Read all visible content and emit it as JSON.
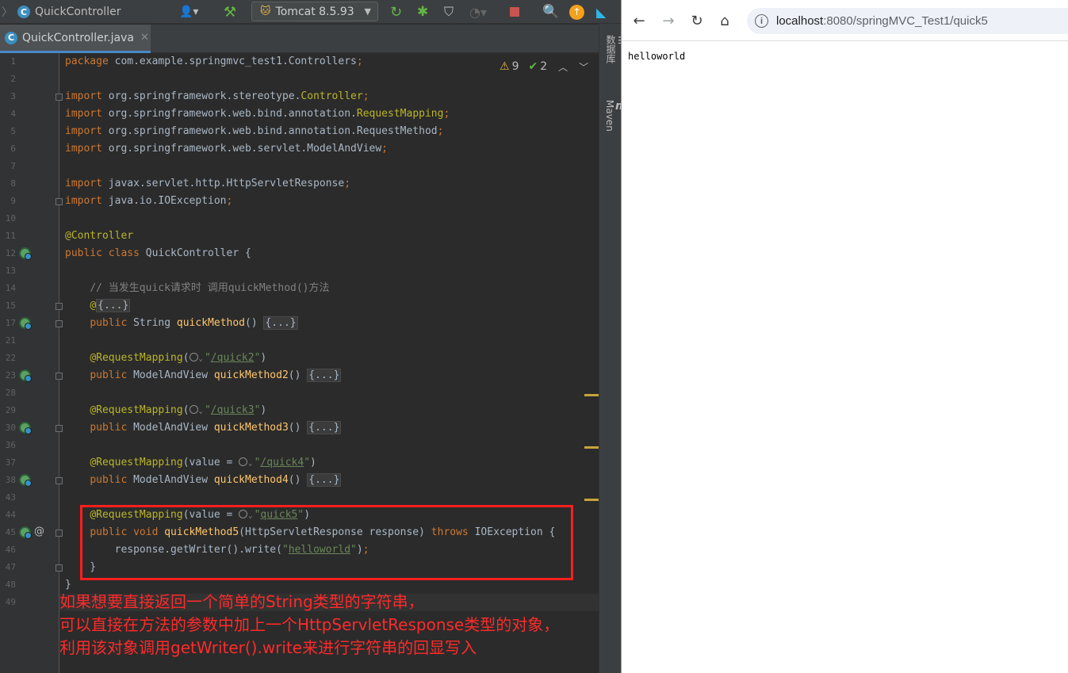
{
  "ide": {
    "project_name": "QuickController",
    "run_config": "Tomcat 8.5.93",
    "tab_label": "QuickController.java",
    "inspections": {
      "warnings": "9",
      "weak_warnings": "2"
    },
    "sidebar": {
      "database_label": "数据库",
      "maven_label": "Maven"
    },
    "code_lines": [
      {
        "ln": "1",
        "parts": [
          [
            "kw",
            "package"
          ],
          [
            "t",
            " com.example.springmvc_test1.Controllers"
          ],
          [
            "kw",
            ";"
          ]
        ]
      },
      {
        "ln": "2",
        "parts": []
      },
      {
        "ln": "3",
        "parts": [
          [
            "kw",
            "import"
          ],
          [
            "t",
            " org.springframework.stereotype."
          ],
          [
            "ann",
            "Controller"
          ],
          [
            "kw",
            ";"
          ]
        ]
      },
      {
        "ln": "4",
        "parts": [
          [
            "kw",
            "import"
          ],
          [
            "t",
            " org.springframework.web.bind.annotation."
          ],
          [
            "ann",
            "RequestMapping"
          ],
          [
            "kw",
            ";"
          ]
        ]
      },
      {
        "ln": "5",
        "parts": [
          [
            "kw",
            "import"
          ],
          [
            "t",
            " org.springframework.web.bind.annotation.RequestMethod"
          ],
          [
            "kw",
            ";"
          ]
        ]
      },
      {
        "ln": "6",
        "parts": [
          [
            "kw",
            "import"
          ],
          [
            "t",
            " org.springframework.web.servlet.ModelAndView"
          ],
          [
            "kw",
            ";"
          ]
        ]
      },
      {
        "ln": "7",
        "parts": []
      },
      {
        "ln": "8",
        "parts": [
          [
            "kw",
            "import"
          ],
          [
            "t",
            " javax.servlet.http.HttpServletResponse"
          ],
          [
            "kw",
            ";"
          ]
        ]
      },
      {
        "ln": "9",
        "parts": [
          [
            "kw",
            "import"
          ],
          [
            "t",
            " java.io.IOException"
          ],
          [
            "kw",
            ";"
          ]
        ]
      },
      {
        "ln": "10",
        "parts": []
      },
      {
        "ln": "11",
        "parts": [
          [
            "ann",
            "@Controller"
          ]
        ]
      },
      {
        "ln": "12",
        "parts": [
          [
            "kw",
            "public class"
          ],
          [
            "t",
            " QuickController {"
          ]
        ]
      },
      {
        "ln": "13",
        "parts": []
      },
      {
        "ln": "14",
        "parts": [
          [
            "t",
            "    "
          ],
          [
            "cm",
            "// 当发生quick请求时 调用quickMethod()方法"
          ]
        ]
      },
      {
        "ln": "15",
        "parts": [
          [
            "t",
            "    "
          ],
          [
            "ann",
            "@"
          ],
          [
            "fold",
            "{...}"
          ]
        ]
      },
      {
        "ln": "17",
        "parts": [
          [
            "t",
            "    "
          ],
          [
            "kw",
            "public"
          ],
          [
            "t",
            " String "
          ],
          [
            "fn",
            "quickMethod"
          ],
          [
            "t",
            "() "
          ],
          [
            "fold",
            "{...}"
          ]
        ]
      },
      {
        "ln": "21",
        "parts": []
      },
      {
        "ln": "22",
        "parts": [
          [
            "t",
            "    "
          ],
          [
            "ann",
            "@RequestMapping"
          ],
          [
            "t",
            "("
          ],
          [
            "globe",
            ""
          ],
          [
            "str",
            "\""
          ],
          [
            "strl",
            "/quick2"
          ],
          [
            "str",
            "\""
          ],
          [
            "t",
            ")"
          ]
        ]
      },
      {
        "ln": "23",
        "parts": [
          [
            "t",
            "    "
          ],
          [
            "kw",
            "public"
          ],
          [
            "t",
            " ModelAndView "
          ],
          [
            "fn",
            "quickMethod2"
          ],
          [
            "t",
            "() "
          ],
          [
            "fold",
            "{...}"
          ]
        ]
      },
      {
        "ln": "28",
        "parts": []
      },
      {
        "ln": "29",
        "parts": [
          [
            "t",
            "    "
          ],
          [
            "ann",
            "@RequestMapping"
          ],
          [
            "t",
            "("
          ],
          [
            "globe",
            ""
          ],
          [
            "str",
            "\""
          ],
          [
            "strl",
            "/quick3"
          ],
          [
            "str",
            "\""
          ],
          [
            "t",
            ")"
          ]
        ]
      },
      {
        "ln": "30",
        "parts": [
          [
            "t",
            "    "
          ],
          [
            "kw",
            "public"
          ],
          [
            "t",
            " ModelAndView "
          ],
          [
            "fn",
            "quickMethod3"
          ],
          [
            "t",
            "() "
          ],
          [
            "fold",
            "{...}"
          ]
        ]
      },
      {
        "ln": "36",
        "parts": []
      },
      {
        "ln": "37",
        "parts": [
          [
            "t",
            "    "
          ],
          [
            "ann",
            "@RequestMapping"
          ],
          [
            "t",
            "(value = "
          ],
          [
            "globe",
            ""
          ],
          [
            "str",
            "\""
          ],
          [
            "strl",
            "/quick4"
          ],
          [
            "str",
            "\""
          ],
          [
            "t",
            ")"
          ]
        ]
      },
      {
        "ln": "38",
        "parts": [
          [
            "t",
            "    "
          ],
          [
            "kw",
            "public"
          ],
          [
            "t",
            " ModelAndView "
          ],
          [
            "fn",
            "quickMethod4"
          ],
          [
            "t",
            "() "
          ],
          [
            "fold",
            "{...}"
          ]
        ]
      },
      {
        "ln": "43",
        "parts": []
      },
      {
        "ln": "44",
        "parts": [
          [
            "t",
            "    "
          ],
          [
            "ann",
            "@RequestMapping"
          ],
          [
            "t",
            "(value = "
          ],
          [
            "globe",
            ""
          ],
          [
            "str",
            "\""
          ],
          [
            "strl",
            "quick5"
          ],
          [
            "str",
            "\""
          ],
          [
            "t",
            ")"
          ]
        ]
      },
      {
        "ln": "45",
        "parts": [
          [
            "t",
            "    "
          ],
          [
            "kw",
            "public void"
          ],
          [
            "t",
            " "
          ],
          [
            "fn",
            "quickMethod5"
          ],
          [
            "t",
            "(HttpServletResponse response) "
          ],
          [
            "kw",
            "throws"
          ],
          [
            "t",
            " IOException {"
          ]
        ]
      },
      {
        "ln": "46",
        "parts": [
          [
            "t",
            "        response.getWriter().write("
          ],
          [
            "str",
            "\""
          ],
          [
            "strl",
            "helloworld"
          ],
          [
            "str",
            "\""
          ],
          [
            "t",
            ")"
          ],
          [
            "kw",
            ";"
          ]
        ]
      },
      {
        "ln": "47",
        "parts": [
          [
            "t",
            "    }"
          ]
        ]
      },
      {
        "ln": "48",
        "parts": [
          [
            "t",
            "}"
          ]
        ]
      },
      {
        "ln": "49",
        "parts": []
      }
    ],
    "annotation_note": [
      "如果想要直接返回一个简单的String类型的字符串，",
      "可以直接在方法的参数中加上一个HttpServletResponse类型的对象，",
      "利用该对象调用getWriter().write来进行字符串的回显写入"
    ]
  },
  "browser": {
    "url_host": "localhost",
    "url_path": ":8080/springMVC_Test1/quick5",
    "page_text": "helloworld"
  },
  "colors": {
    "keyword": "#cc7832",
    "annotation": "#bbb529",
    "string": "#6a8759",
    "highlight_red": "#ff1f1f"
  }
}
